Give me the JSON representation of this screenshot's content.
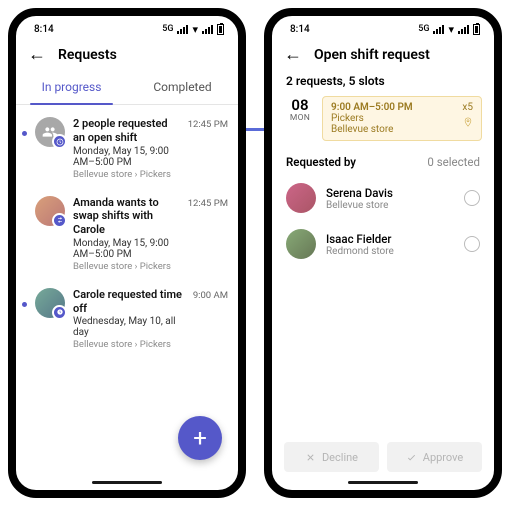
{
  "status": {
    "time": "8:14",
    "network": "5G"
  },
  "left": {
    "title": "Requests",
    "tabs": {
      "inProgress": "In progress",
      "completed": "Completed"
    },
    "items": [
      {
        "title": "2 people requested an open shift",
        "subtitle": "Monday, May 15, 9:00 AM–5:00 PM",
        "crumb_store": "Bellevue store",
        "crumb_group": "Pickers",
        "time": "12:45 PM"
      },
      {
        "title": "Amanda wants to swap shifts with Carole",
        "subtitle": "Monday, May 15, 9:00 AM–5:00 PM",
        "crumb_store": "Bellevue store",
        "crumb_group": "Pickers",
        "time": "12:45 PM"
      },
      {
        "title": "Carole requested time off",
        "subtitle": "Wednesday, May 10, all day",
        "crumb_store": "Bellevue store",
        "crumb_group": "Pickers",
        "time": "9:00 AM"
      }
    ]
  },
  "right": {
    "title": "Open shift request",
    "summary": "2 requests, 5 slots",
    "date": {
      "num": "08",
      "dow": "MON"
    },
    "shift": {
      "time": "9:00 AM–5:00 PM",
      "group": "Pickers",
      "store": "Bellevue store",
      "count": "x5"
    },
    "reqby_label": "Requested by",
    "selected_label": "0 selected",
    "people": [
      {
        "name": "Serena Davis",
        "store": "Bellevue store"
      },
      {
        "name": "Isaac Fielder",
        "store": "Redmond store"
      }
    ],
    "buttons": {
      "decline": "Decline",
      "approve": "Approve"
    }
  }
}
